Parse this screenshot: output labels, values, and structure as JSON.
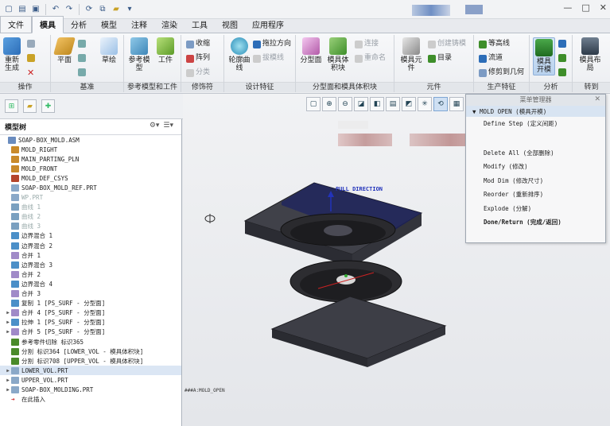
{
  "quick_access": {
    "icons": [
      "new-icon",
      "open-icon",
      "save-icon",
      "undo-icon",
      "redo-icon",
      "regenerate-icon",
      "windows-icon",
      "folder-icon"
    ]
  },
  "window": {
    "minimize": "—",
    "maximize": "□",
    "close": "✕"
  },
  "tabs": [
    "文件",
    "模具",
    "分析",
    "模型",
    "注释",
    "渲染",
    "工具",
    "视图",
    "应用程序"
  ],
  "active_tab": "模具",
  "ribbon": {
    "groups": [
      "操作",
      "基准",
      "参考模型和工件",
      "修饰符",
      "设计特征",
      "分型面和模具体积块",
      "元件",
      "生产特征",
      "分析",
      "转到"
    ],
    "regen": "重新生成",
    "plane": "平面",
    "sketch": "草绘",
    "refmodel": "参考模型",
    "workpiece": "工件",
    "shrink": "收缩",
    "array": "阵列",
    "classify": "分类",
    "silhouette": "轮廓曲线",
    "draft_dir": "拖拉方向",
    "draft_check": "拔模线",
    "parting": "分型面",
    "mold_vol": "模具体积块",
    "connect": "连接",
    "rename": "重命名",
    "mold_comp": "模具元件",
    "create_cast": "创建铸模",
    "catalog": "目录",
    "contour": "等高线",
    "runner": "流道",
    "trim_geom": "修剪到几何",
    "mold_open": "模具开模",
    "mold_layout": "模具布局"
  },
  "model_tree": {
    "title": "模型树",
    "items": [
      {
        "label": "SOAP-BOX_MOLD.ASM",
        "icon": "assembly-icon",
        "indent": 0,
        "exp": "",
        "grey": false
      },
      {
        "label": "MOLD_RIGHT",
        "icon": "plane-icon",
        "indent": 1,
        "exp": "",
        "grey": false
      },
      {
        "label": "MAIN_PARTING_PLN",
        "icon": "plane-icon",
        "indent": 1,
        "exp": "",
        "grey": false
      },
      {
        "label": "MOLD_FRONT",
        "icon": "plane-icon",
        "indent": 1,
        "exp": "",
        "grey": false
      },
      {
        "label": "MOLD_DEF_CSYS",
        "icon": "csys-icon",
        "indent": 1,
        "exp": "",
        "grey": false
      },
      {
        "label": "SOAP-BOX_MOLD_REF.PRT",
        "icon": "part-icon",
        "indent": 1,
        "exp": "",
        "grey": false
      },
      {
        "label": "WP.PRT",
        "icon": "part-icon",
        "indent": 1,
        "exp": "",
        "grey": true
      },
      {
        "label": "曲线 1",
        "icon": "curve-icon",
        "indent": 1,
        "exp": "",
        "grey": true
      },
      {
        "label": "曲线 2",
        "icon": "curve-icon",
        "indent": 1,
        "exp": "",
        "grey": true
      },
      {
        "label": "曲线 3",
        "icon": "curve-icon",
        "indent": 1,
        "exp": "",
        "grey": true
      },
      {
        "label": "边界混合 1",
        "icon": "surface-icon",
        "indent": 1,
        "exp": "",
        "grey": false
      },
      {
        "label": "边界混合 2",
        "icon": "surface-icon",
        "indent": 1,
        "exp": "",
        "grey": false
      },
      {
        "label": "合并 1",
        "icon": "merge-icon",
        "indent": 1,
        "exp": "",
        "grey": false
      },
      {
        "label": "边界混合 3",
        "icon": "surface-icon",
        "indent": 1,
        "exp": "",
        "grey": false
      },
      {
        "label": "合并 2",
        "icon": "merge-icon",
        "indent": 1,
        "exp": "",
        "grey": false
      },
      {
        "label": "边界混合 4",
        "icon": "surface-icon",
        "indent": 1,
        "exp": "",
        "grey": false
      },
      {
        "label": "合并 3",
        "icon": "merge-icon",
        "indent": 1,
        "exp": "",
        "grey": false
      },
      {
        "label": "复制 1 [PS_SURF - 分型面]",
        "icon": "copy-icon",
        "indent": 1,
        "exp": "",
        "grey": false
      },
      {
        "label": "合并 4 [PS_SURF - 分型面]",
        "icon": "merge-icon",
        "indent": 1,
        "exp": "▶",
        "grey": false
      },
      {
        "label": "拉伸 1 [PS_SURF - 分型面]",
        "icon": "extrude-icon",
        "indent": 1,
        "exp": "▶",
        "grey": false
      },
      {
        "label": "合并 5 [PS_SURF - 分型面]",
        "icon": "merge-icon",
        "indent": 1,
        "exp": "▶",
        "grey": false
      },
      {
        "label": "参考零件切除 标识365",
        "icon": "cut-icon",
        "indent": 1,
        "exp": "",
        "grey": false
      },
      {
        "label": "分割 标识364 [LOWER_VOL - 模具体积块]",
        "icon": "split-icon",
        "indent": 1,
        "exp": "",
        "grey": false
      },
      {
        "label": "分割 标识708 [UPPER_VOL - 模具体积块]",
        "icon": "split-icon",
        "indent": 1,
        "exp": "",
        "grey": false
      },
      {
        "label": "LOWER_VOL.PRT",
        "icon": "part-icon",
        "indent": 1,
        "exp": "▶",
        "grey": false
      },
      {
        "label": "UPPER_VOL.PRT",
        "icon": "part-icon",
        "indent": 1,
        "exp": "▶",
        "grey": false
      },
      {
        "label": "SOAP-BOX_MOLDING.PRT",
        "icon": "part-icon",
        "indent": 1,
        "exp": "▶",
        "grey": false
      },
      {
        "label": "在此插入",
        "icon": "insert-icon",
        "indent": 1,
        "exp": "",
        "grey": false
      }
    ]
  },
  "menu_manager": {
    "title": "菜单管理器",
    "header": "MOLD OPEN (模具开模)",
    "items": [
      "Define Step (定义间距)",
      "Delete All (全部删除)",
      "Modify (修改)",
      "Mod Dim (修改尺寸)",
      "Reorder (重新排序)",
      "Explode (分解)",
      "Done/Return (完成/返回)"
    ]
  },
  "viewport": {
    "pull_direction": "PULL DIRECTION",
    "status": "###A:MOLD_OPEN"
  },
  "colors": {
    "accent": "#3a5b88",
    "mold_plate": "#3f4048",
    "part": "#2a2a2a",
    "pull_arrow": "#2233bb"
  }
}
